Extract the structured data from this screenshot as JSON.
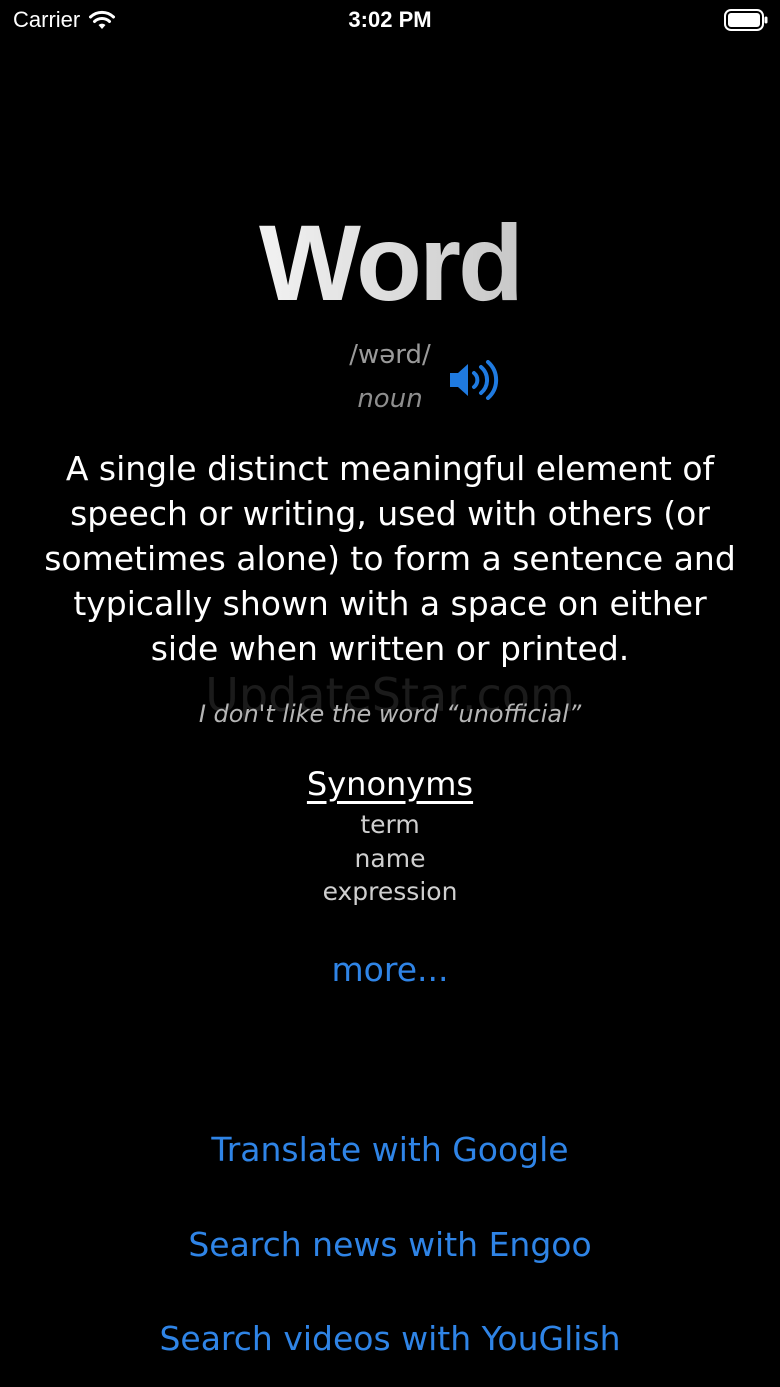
{
  "status_bar": {
    "carrier": "Carrier",
    "time": "3:02 PM",
    "icons": [
      "wifi-icon",
      "battery-icon"
    ]
  },
  "entry": {
    "word": "Word",
    "phonetic": "/wərd/",
    "part_of_speech": "noun",
    "definition": "A single distinct meaningful element of speech or writing, used with others (or sometimes alone) to form a sentence and typically shown with a space on either side when written or printed.",
    "watermark": "UpdateStar.com",
    "example": "I don't like the word “unofficial”",
    "synonyms_heading": "Synonyms",
    "synonyms": [
      "term",
      "name",
      "expression"
    ],
    "more_label": "more..."
  },
  "actions": {
    "translate_label": "Translate with Google",
    "news_label": "Search news with Engoo",
    "videos_label": "Search videos with YouGlish"
  },
  "colors": {
    "background": "#000000",
    "link": "#2f84e6",
    "speaker_icon": "#1f7ae0"
  }
}
